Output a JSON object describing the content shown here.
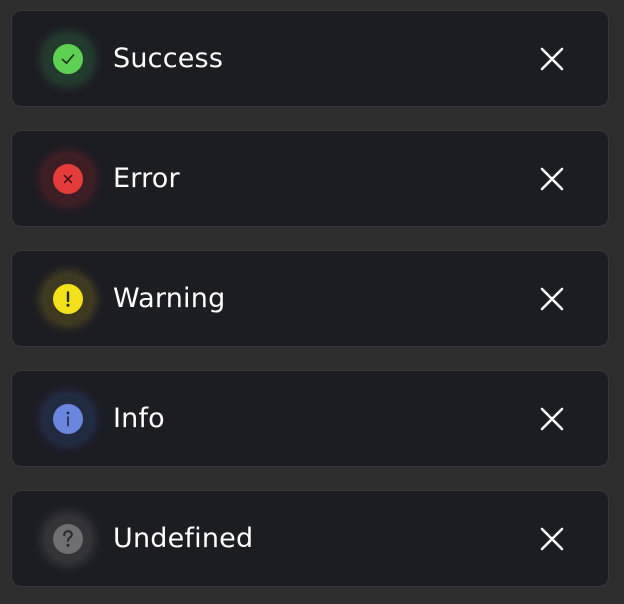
{
  "toasts": [
    {
      "label": "Success",
      "icon": "check-icon",
      "accent": "#5fd152",
      "halo": "#2a4a36"
    },
    {
      "label": "Error",
      "icon": "x-icon",
      "accent": "#e43b3b",
      "halo": "#4a1f24"
    },
    {
      "label": "Warning",
      "icon": "exclamation-icon",
      "accent": "#f1e01a",
      "halo": "#4a4322"
    },
    {
      "label": "Info",
      "icon": "info-icon",
      "accent": "#6b86df",
      "halo": "#253049"
    },
    {
      "label": "Undefined",
      "icon": "question-icon",
      "accent": "#6f6f73",
      "halo": "#38383d"
    }
  ],
  "close_icon": "close-icon"
}
